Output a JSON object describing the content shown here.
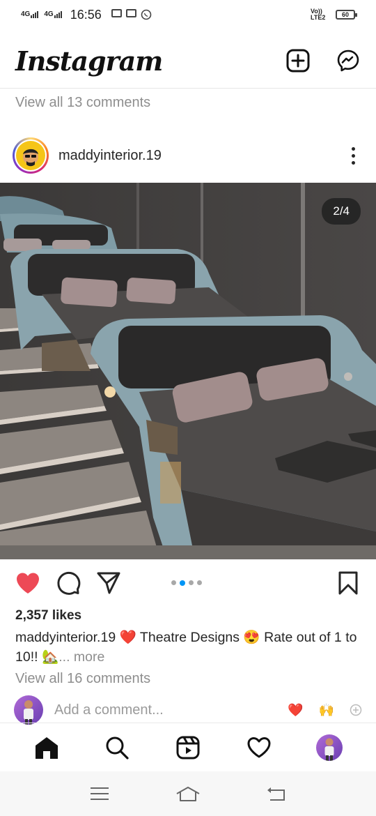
{
  "status_bar": {
    "signal1": "4G",
    "signal2": "4G",
    "time": "16:56",
    "volte": "Vo)) LTE2",
    "battery": "60"
  },
  "header": {
    "logo": "Instagram",
    "new_post_icon": "plus-square-icon",
    "messenger_icon": "messenger-icon"
  },
  "feed": {
    "previous_post_comments": "View all 13 comments"
  },
  "post": {
    "username": "maddyinterior.19",
    "image_counter": "2/4",
    "carousel": {
      "total": 4,
      "current": 2
    },
    "likes": "2,357 likes",
    "caption_user": "maddyinterior.19",
    "caption_text": " ❤️ Theatre Designs 😍 Rate out of 1 to 10!! 🏡",
    "caption_more": "... more",
    "view_comments": "View all 16 comments",
    "add_comment_placeholder": "Add a comment...",
    "quick_reactions": [
      "❤️",
      "🙌"
    ]
  },
  "colors": {
    "like_red": "#ed4956",
    "dot_active": "#0095f6",
    "muted_text": "#8e8e8e"
  },
  "bottom_nav": {
    "items": [
      "home-icon",
      "search-icon",
      "reels-icon",
      "heart-icon",
      "profile-avatar"
    ]
  },
  "system_nav": {
    "items": [
      "menu-icon",
      "home-outline-icon",
      "back-icon"
    ]
  }
}
